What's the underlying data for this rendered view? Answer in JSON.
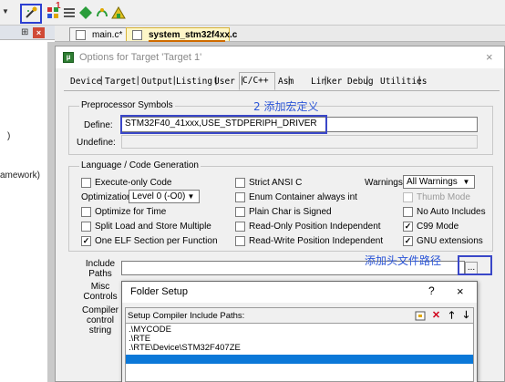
{
  "ide": {
    "tabs": [
      "main.c*",
      "system_stm32f4xx.c"
    ],
    "step_badge": "1",
    "left_fragments": [
      ")",
      "amework)"
    ],
    "right_ruler": [
      "s",
      "s",
      "s",
      "s",
      "s"
    ]
  },
  "options": {
    "title": "Options for Target 'Target 1'",
    "close": "×",
    "tabs": [
      "Device",
      "Target",
      "Output",
      "Listing",
      "User",
      "C/C++",
      "Asm",
      "Linker",
      "Debug",
      "Utilities"
    ],
    "active_tab": "C/C++",
    "preprocessor": {
      "group_title": "Preprocessor Symbols",
      "define_label": "Define:",
      "define_value": "STM32F40_41xxx,USE_STDPERIPH_DRIVER",
      "undefine_label": "Undefine:",
      "undefine_value": "",
      "annotation": "2 添加宏定义"
    },
    "codegen": {
      "group_title": "Language / Code Generation",
      "execute_only": "Execute-only Code",
      "optimization_label": "Optimization:",
      "optimization_value": "Level 0 (-O0)",
      "optimize_time": "Optimize for Time",
      "split_load": "Split Load and Store Multiple",
      "one_elf": "One ELF Section per Function",
      "strict_ansi": "Strict ANSI C",
      "enum_container": "Enum Container always int",
      "plain_char": "Plain Char is Signed",
      "ro_pi": "Read-Only Position Independent",
      "rw_pi": "Read-Write Position Independent",
      "warnings_label": "Warnings:",
      "warnings_value": "All Warnings",
      "thumb_mode": "Thumb Mode",
      "no_auto_includes": "No Auto Includes",
      "c99_mode": "C99 Mode",
      "gnu_extensions": "GNU extensions",
      "checked": {
        "execute_only": false,
        "optimize_time": false,
        "split_load": false,
        "one_elf": true,
        "strict_ansi": false,
        "enum_container": false,
        "plain_char": false,
        "ro_pi": false,
        "rw_pi": false,
        "thumb_mode": false,
        "no_auto_includes": false,
        "c99_mode": true,
        "gnu_extensions": true
      }
    },
    "include_paths_label": "Include Paths",
    "misc_controls_label": "Misc Controls",
    "compiler_control_label": "Compiler control string",
    "browse_button": "...",
    "include_annotation": "添加头文件路径"
  },
  "folder_setup": {
    "title": "Folder Setup",
    "help": "?",
    "close": "×",
    "list_header": "Setup Compiler Include Paths:",
    "items": [
      ".\\MYCODE",
      ".\\RTE",
      ".\\RTE\\Device\\STM32F407ZE"
    ],
    "selected_row_text": ""
  },
  "colors": {
    "annotation_blue": "#2c56d8",
    "highlight_box": "#3a47c8",
    "selection": "#0b78d8",
    "delete_icon": "#d0021b"
  }
}
